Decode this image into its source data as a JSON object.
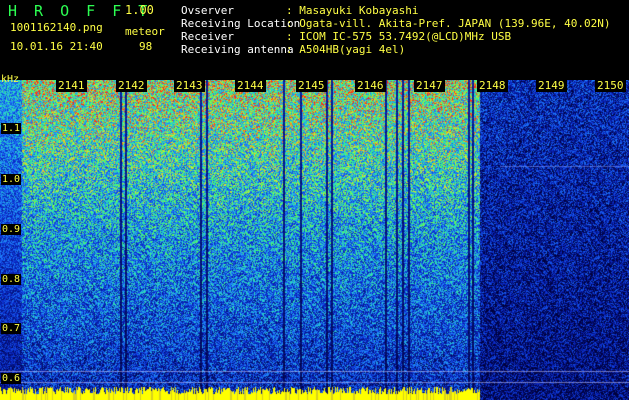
{
  "app": {
    "title": "H R O F F T",
    "version": "1.00",
    "filename": "1001162140.png",
    "datetime": "10.01.16 21:40",
    "meteor_label": "meteor",
    "meteor_count": "98"
  },
  "info": [
    {
      "label": "Ovserver",
      "value": ": Masayuki Kobayashi"
    },
    {
      "label": "Receiving Location",
      "value": ": Ogata-vill. Akita-Pref. JAPAN (139.96E, 40.02N)"
    },
    {
      "label": "Receiver",
      "value": ": ICOM IC-575 53.7492(@LCD)MHz USB"
    },
    {
      "label": "Receiving antenna",
      "value": ": A504HB(yagi 4el)"
    }
  ],
  "spectrogram": {
    "freq_unit": "kHz",
    "freq_labels": [
      "1.1",
      "1.0",
      "0.9",
      "0.8",
      "0.7",
      "0.6"
    ],
    "time_labels": [
      "2141",
      "2142",
      "2143",
      "2144",
      "2145",
      "2146",
      "2147",
      "2148",
      "2149",
      "2150"
    ],
    "colors": {
      "low": "#00004a",
      "mid": "#1a6bff",
      "high": "#3cff6a",
      "peak": "#ff3a1a",
      "meteor_bar": "#ffff00"
    }
  }
}
